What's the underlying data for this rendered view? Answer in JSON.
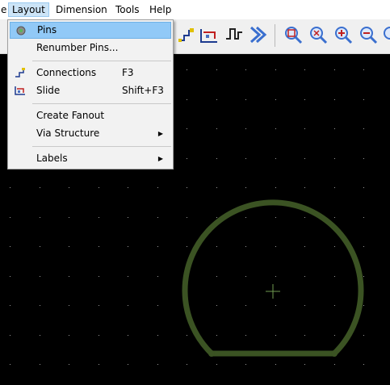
{
  "menubar": {
    "items": [
      {
        "label": "e"
      },
      {
        "label": "Layout"
      },
      {
        "label": "Dimension"
      },
      {
        "label": "Tools"
      },
      {
        "label": "Help"
      }
    ]
  },
  "toolbar": {
    "icons": [
      "route-icon",
      "slide-icon",
      "pulse-icon",
      "chevron-right-icon",
      "zoom-area-icon",
      "zoom-fit-icon",
      "zoom-in-icon",
      "zoom-out-icon",
      "zoom-previous-icon"
    ]
  },
  "layout_menu": {
    "items": [
      {
        "label": "Pins",
        "icon": "pins-icon"
      },
      {
        "label": "Renumber Pins..."
      },
      {
        "label": "Connections",
        "shortcut": "F3",
        "icon": "connections-icon"
      },
      {
        "label": "Slide",
        "shortcut": "Shift+F3",
        "icon": "slide-icon"
      },
      {
        "label": "Create Fanout"
      },
      {
        "label": "Via Structure",
        "submenu": true
      },
      {
        "label": "Labels",
        "submenu": true
      }
    ]
  },
  "canvas": {
    "background": "#000000",
    "grid_color": "#9a9a9a",
    "outline_color": "#3b5323",
    "cursor_color": "#6f9a4f"
  }
}
